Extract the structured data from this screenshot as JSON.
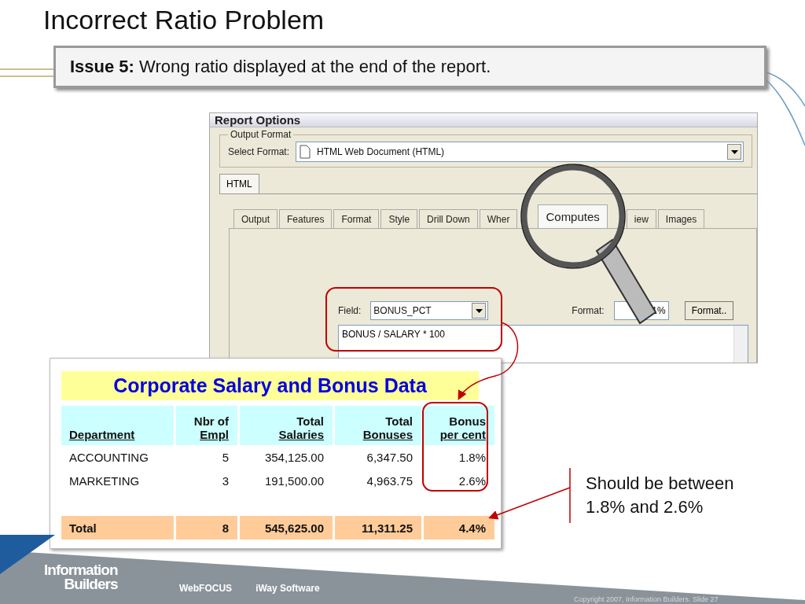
{
  "slide": {
    "title": "Incorrect Ratio Problem",
    "issue": "**Issue 5:** Wrong ratio displayed at the end of the report."
  },
  "dialog": {
    "title": "Report Options",
    "group_label": "Output Format",
    "select_label": "Select Format:",
    "select_value": "HTML Web Document (HTML)",
    "outer_tabs": [
      {
        "label": "HTML",
        "selected": true
      }
    ],
    "tabs": [
      {
        "label": "Output",
        "selected": false
      },
      {
        "label": "Features",
        "selected": false
      },
      {
        "label": "Format",
        "selected": false
      },
      {
        "label": "Style",
        "selected": false
      },
      {
        "label": "Drill Down",
        "selected": false
      },
      {
        "label": "Wher",
        "selected": false
      },
      {
        "label": "Computes",
        "selected": true
      },
      {
        "label": "iew",
        "selected": false
      },
      {
        "label": "Images",
        "selected": false
      }
    ],
    "field_label": "Field:",
    "field_value": "BONUS_PCT",
    "format_label": "Format:",
    "format_value": "1%",
    "format_button": "Format..",
    "formula": "BONUS / SALARY * 100"
  },
  "report": {
    "title": "Corporate Salary and Bonus Data",
    "columns": [
      {
        "bottom": "Department"
      },
      {
        "top": "Nbr of",
        "bottom": "Empl"
      },
      {
        "top": "Total",
        "bottom": "Salaries"
      },
      {
        "top": "Total",
        "bottom": "Bonuses"
      },
      {
        "top": "Bonus",
        "bottom": "per cent"
      }
    ],
    "rows": [
      [
        "ACCOUNTING",
        "5",
        "354,125.00",
        "6,347.50",
        "1.8%"
      ],
      [
        "MARKETING",
        "3",
        "191,500.00",
        "4,963.75",
        "2.6%"
      ]
    ],
    "total": [
      "Total",
      "8",
      "545,625.00",
      "11,311.25",
      "4.4%"
    ]
  },
  "note": "Should be between 1.8% and 2.6%",
  "footer": {
    "logo_top": "Information",
    "logo_bottom": "Builders",
    "products": [
      "WebFOCUS",
      "iWay Software"
    ],
    "copyright": "Copyright 2007, Information Builders. Slide 27"
  }
}
